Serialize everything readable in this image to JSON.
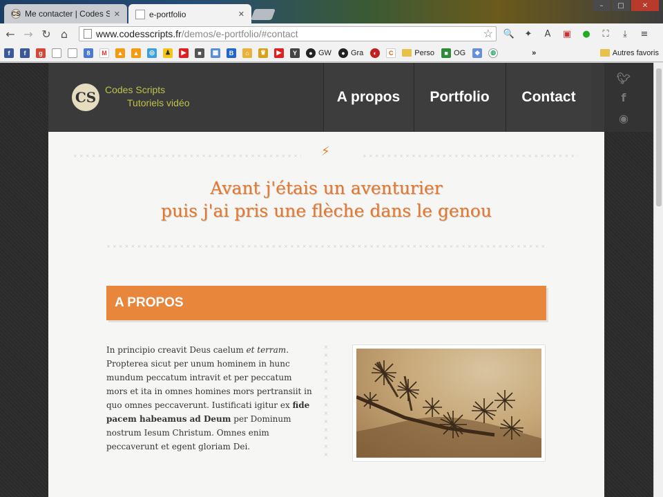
{
  "browser": {
    "tabs": [
      {
        "title": "Me contacter | Codes Scrip",
        "favicon": "CS",
        "active": false
      },
      {
        "title": "e-portfolio",
        "active": true
      }
    ],
    "url": {
      "domain": "www.codesscripts.fr",
      "path": "/demos/e-portfolio/#contact"
    },
    "bookmarks_text": [
      {
        "label": "GW"
      },
      {
        "label": "Gra"
      },
      {
        "label": "Perso"
      },
      {
        "label": "OG"
      }
    ],
    "other_bookmarks": "Autres favoris",
    "overflow": "»"
  },
  "site": {
    "logo": {
      "badge": "CS",
      "line1": "Codes Scripts",
      "line2": "Tutoriels vidéo"
    },
    "nav": [
      "A propos",
      "Portfolio",
      "Contact"
    ],
    "social_icons": [
      "twitter-icon",
      "facebook-icon",
      "dribbble-icon"
    ]
  },
  "hero": {
    "line1": "Avant j'étais un aventurier",
    "line2": "puis j'ai pris une flèche dans le genou"
  },
  "about": {
    "title": "A PROPOS",
    "text_a": "In principio creavit Deus caelum ",
    "text_b": "et terram",
    "text_c": ". Propterea sicut per unum hominem in hunc mundum peccatum intravit et per peccatum mors et ita in omnes homines mors pertransiit in quo omnes peccaverunt. Iustificati igitur ex ",
    "text_d": "fide pacem habeamus ad Deum",
    "text_e": " per Dominum nostrum Iesum Christum. Omnes enim peccaverunt et egent gloriam Dei."
  },
  "colors": {
    "accent": "#e8863b",
    "title": "#e8762b",
    "logo_text": "#bcc24b",
    "header_bg": "#3a3a3a"
  }
}
